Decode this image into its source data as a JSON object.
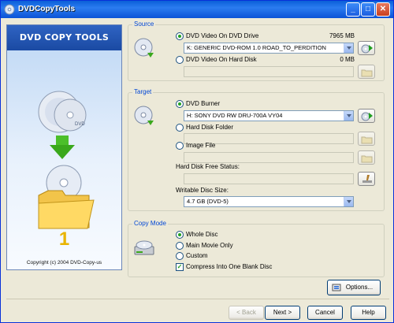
{
  "window": {
    "title": "DVDCopyTools",
    "controls": [
      "_",
      "□",
      "✕"
    ]
  },
  "banner": {
    "heading": "DVD COPY TOOLS",
    "step_number": "1",
    "copyright": "Copyright (c) 2004 DVD-Copy-us",
    "icons": [
      "dvd-disc-icon",
      "down-arrow-icon",
      "disc-folder-icon"
    ]
  },
  "source": {
    "label": "Source",
    "opt_drive": "DVD Video On DVD Drive",
    "drive_size": "7965 MB",
    "drive_value": "K: GENERIC  DVD-ROM       1.0 ROAD_TO_PERDITION",
    "opt_hdd": "DVD Video On Hard Disk",
    "hdd_size": "0 MB",
    "hdd_value": ""
  },
  "target": {
    "label": "Target",
    "opt_burner": "DVD Burner",
    "burner_value": "H: SONY    DVD RW DRU-700A  VY04",
    "opt_folder": "Hard Disk Folder",
    "folder_value": "",
    "opt_image": "Image File",
    "image_value": "",
    "free_status_label": "Hard Disk Free Status:",
    "free_status_value": "",
    "disc_size_label": "Writable Disc Size:",
    "disc_size_value": "4.7 GB (DVD-5)"
  },
  "copy_mode": {
    "label": "Copy Mode",
    "opt_whole": "Whole Disc",
    "opt_main": "Main Movie Only",
    "opt_custom": "Custom",
    "compress": "Compress Into One Blank Disc"
  },
  "buttons": {
    "options": "Options...",
    "back": "< Back",
    "next": "Next >",
    "cancel": "Cancel",
    "help": "Help"
  },
  "colors": {
    "accent": "#0046d5",
    "title_bar": "#0a5fd8",
    "check_green": "#21a121"
  }
}
